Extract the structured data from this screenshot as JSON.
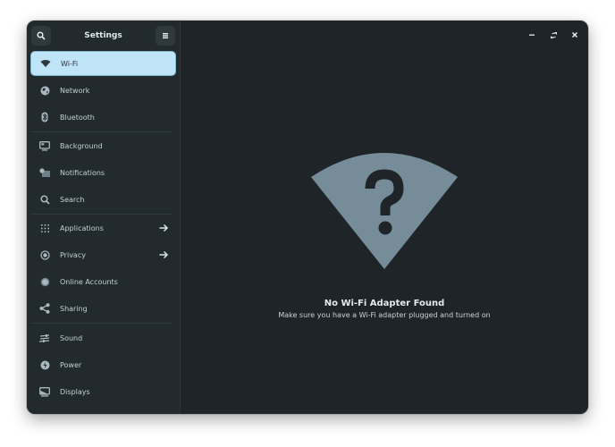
{
  "window": {
    "title": "Settings",
    "controls": {
      "minimize": "minimize-icon",
      "maximize": "restore-icon",
      "close": "close-icon"
    }
  },
  "sidebar": {
    "search_icon": "search-icon",
    "menu_icon": "hamburger-menu-icon",
    "items": [
      {
        "label": "Wi-Fi",
        "icon": "wifi-icon",
        "selected": true
      },
      {
        "label": "Network",
        "icon": "globe-icon"
      },
      {
        "label": "Bluetooth",
        "icon": "bluetooth-icon"
      },
      {
        "label": "Background",
        "icon": "monitor-background-icon"
      },
      {
        "label": "Notifications",
        "icon": "notifications-icon"
      },
      {
        "label": "Search",
        "icon": "search-icon"
      },
      {
        "label": "Applications",
        "icon": "apps-grid-icon",
        "has_arrow": true
      },
      {
        "label": "Privacy",
        "icon": "privacy-icon",
        "has_arrow": true
      },
      {
        "label": "Online Accounts",
        "icon": "online-accounts-icon"
      },
      {
        "label": "Sharing",
        "icon": "share-icon"
      },
      {
        "label": "Sound",
        "icon": "sound-sliders-icon"
      },
      {
        "label": "Power",
        "icon": "power-icon"
      },
      {
        "label": "Displays",
        "icon": "displays-icon"
      }
    ]
  },
  "main": {
    "empty_state": {
      "icon": "wifi-question-icon",
      "title": "No Wi-Fi Adapter Found",
      "description": "Make sure you have a Wi-Fi adapter plugged and turned on"
    }
  },
  "colors": {
    "selected_bg": "#bfe3f7",
    "icon_fill": "#768d99",
    "sidebar_bg": "#222a2e",
    "main_bg": "#1e2428"
  }
}
